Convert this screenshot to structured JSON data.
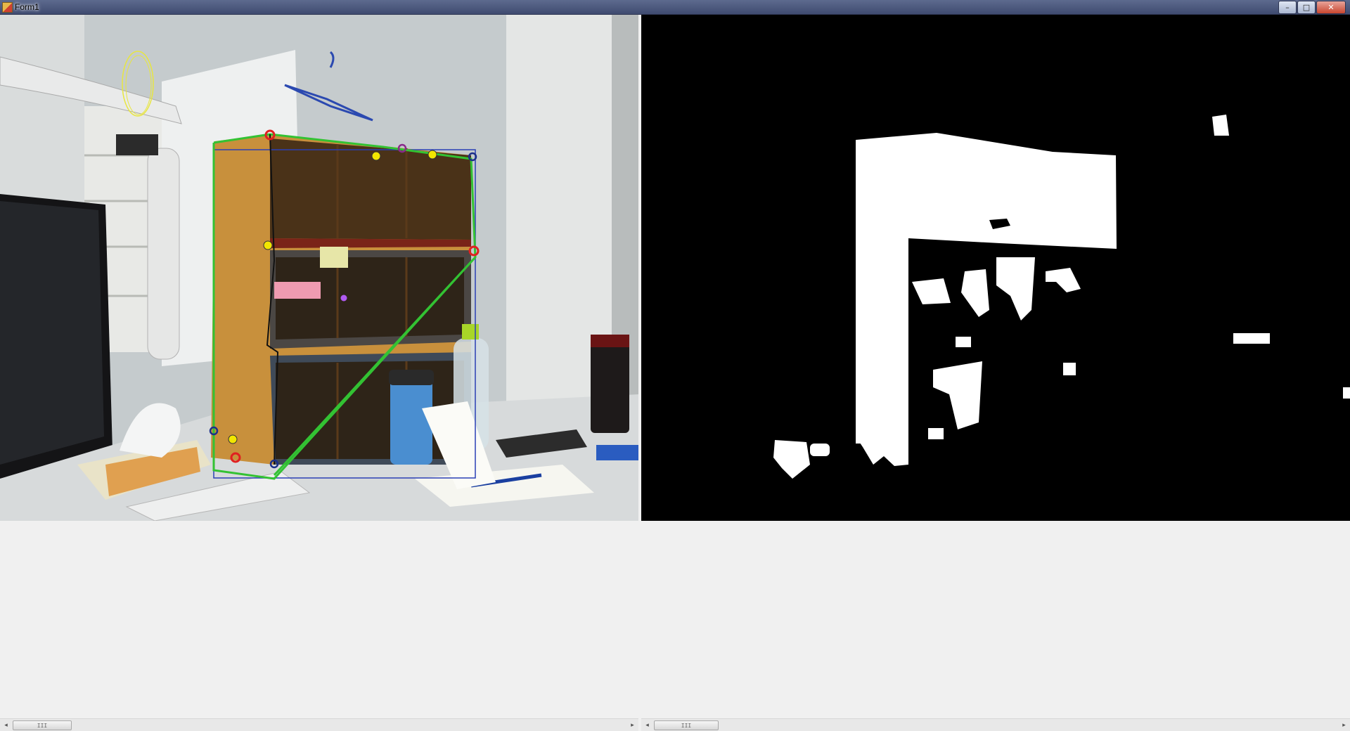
{
  "window": {
    "title": "Form1",
    "minimize": "–",
    "maximize": "□",
    "close": "✕"
  },
  "panels": {
    "left": {
      "kind": "camera-frame",
      "content": "office shelf with detected contour overlay"
    },
    "right": {
      "kind": "binary-mask"
    }
  },
  "scrollbars": {
    "left": {
      "left_arrow": "◂",
      "right_arrow": "▸",
      "grip": "III"
    },
    "right": {
      "left_arrow": "◂",
      "right_arrow": "▸",
      "grip": "III"
    }
  },
  "colors": {
    "contour": "#33c233",
    "bbox": "#2a3fb5",
    "marker_red": "#e02020",
    "marker_yellow": "#f2e600",
    "marker_navy": "#1c2f8a",
    "marker_purple": "#8a2a8a",
    "center_point": "#b05af0"
  }
}
